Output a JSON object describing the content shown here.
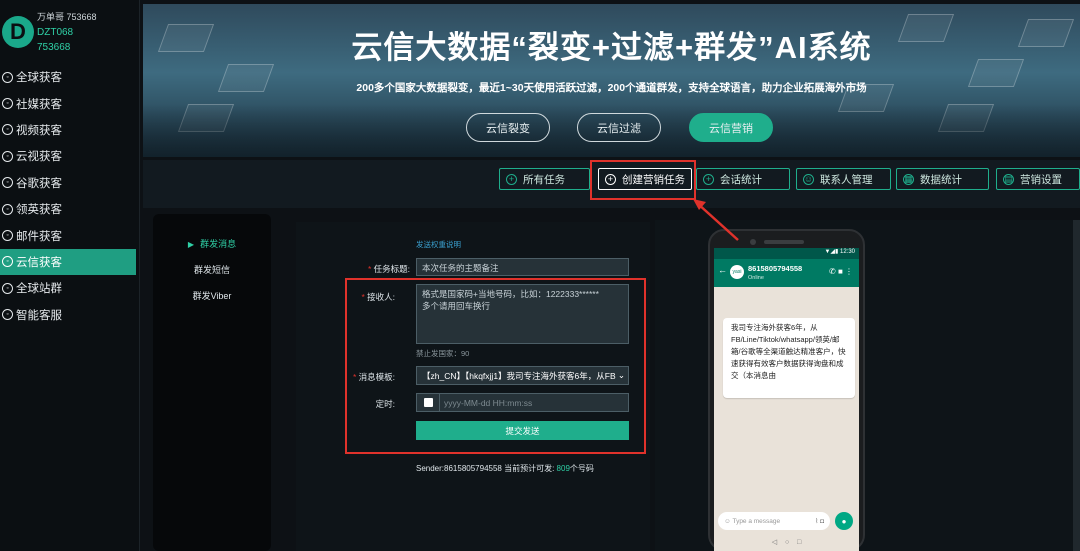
{
  "user": {
    "line1": "万单哥 753668",
    "line2": "DZT068",
    "line3": "753668",
    "logo_letter": "D"
  },
  "sidebar": {
    "items": [
      {
        "label": "全球获客",
        "icon": "globe-icon"
      },
      {
        "label": "社媒获客",
        "icon": "share-icon"
      },
      {
        "label": "视频获客",
        "icon": "video-icon"
      },
      {
        "label": "云视获客",
        "icon": "cloud-icon"
      },
      {
        "label": "谷歌获客",
        "icon": "google-icon"
      },
      {
        "label": "领英获客",
        "icon": "linkedin-icon"
      },
      {
        "label": "邮件获客",
        "icon": "mail-icon"
      },
      {
        "label": "云信获客",
        "icon": "message-icon",
        "active": true
      },
      {
        "label": "全球站群",
        "icon": "sites-icon"
      },
      {
        "label": "智能客服",
        "icon": "service-icon"
      }
    ]
  },
  "banner": {
    "title": "云信大数据“裂变+过滤+群发”AI系统",
    "subtitle": "200多个国家大数据裂变，最近1~30天使用活跃过滤，200个通道群发，支持全球语言，助力企业拓展海外市场",
    "buttons": [
      "云信裂变",
      "云信过滤",
      "云信营销"
    ],
    "active_button": "云信营销"
  },
  "tabs": [
    {
      "label": "所有任务",
      "icon": "+"
    },
    {
      "label": "创建营销任务",
      "icon": "+",
      "selected": true
    },
    {
      "label": "会话统计",
      "icon": "+"
    },
    {
      "label": "联系人管理",
      "icon": "☺"
    },
    {
      "label": "数据统计",
      "icon": "▦"
    },
    {
      "label": "营销设置",
      "icon": "▤"
    }
  ],
  "subnav": {
    "items": [
      "群发消息",
      "群发短信",
      "群发Viber"
    ],
    "active": "群发消息"
  },
  "form": {
    "help_link": "发送权重说明",
    "title_label": "任务标题:",
    "title_value": "本次任务的主题备注",
    "recipient_label": "接收人:",
    "recipient_value": "格式是国家码+当地号码，比如：1222333******\n多个请用回车换行",
    "recipient_hint": "禁止发国家：90",
    "template_label": "消息模板:",
    "template_value": "【zh_CN】【hkqfxjj1】我司专注海外获客6年，从FB",
    "schedule_label": "定时:",
    "schedule_placeholder": "yyyy-MM-dd HH:mm:ss",
    "submit_label": "提交发送",
    "sender_text": "Sender:8615805794558 当前预计可发:",
    "sender_count": "809",
    "sender_unit": "个号码"
  },
  "phone": {
    "time": "12:30",
    "contact": "8615805794558",
    "status": "Online",
    "avatar_text": "yasi",
    "message": "我司专注海外获客6年，从FB/Line/Tiktok/whatsapp/领英/邮箱/谷歌等全渠道触达精准客户，快速获得有效客户数据获得询盘和成交（本消息由",
    "input_placeholder": "Type a message"
  },
  "colors": {
    "accent": "#1fae8c",
    "highlight": "#e0322b",
    "sidebar_active": "#1f9e82"
  }
}
